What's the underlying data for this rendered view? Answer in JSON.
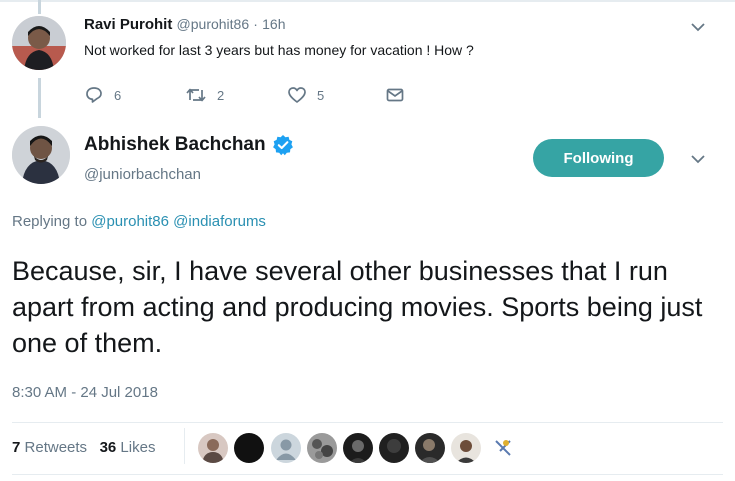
{
  "reply_tweet": {
    "name": "Ravi Purohit",
    "handle": "@purohit86",
    "separator": "·",
    "time": "16h",
    "text": "Not worked for last 3 years but has money for vacation ! How ?",
    "actions": {
      "reply_count": "6",
      "retweet_count": "2",
      "like_count": "5"
    }
  },
  "main_tweet": {
    "name": "Abhishek Bachchan",
    "handle": "@juniorbachchan",
    "follow_label": "Following",
    "replying_prefix": "Replying to",
    "replying_to": [
      "@purohit86",
      "@indiaforums"
    ],
    "text": "Because, sir, I have several other businesses that I run apart from acting and producing movies. Sports being just one of them.",
    "timestamp": "8:30 AM - 24 Jul 2018",
    "stats": {
      "retweets_count": "7",
      "retweets_label": "Retweets",
      "likes_count": "36",
      "likes_label": "Likes"
    }
  },
  "colors": {
    "follow_button": "#36a4a4",
    "mention": "#2a90b2",
    "verified": "#1da1f2",
    "muted": "#657786"
  }
}
